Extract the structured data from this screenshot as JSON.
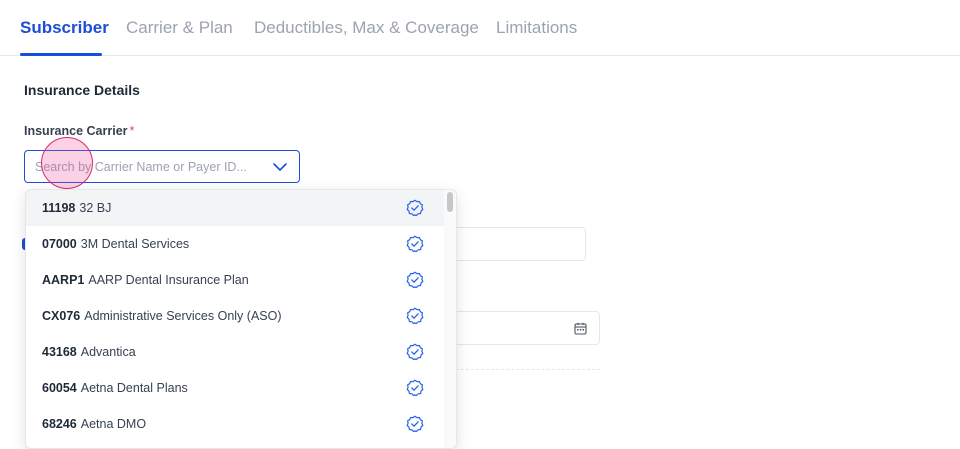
{
  "tabs": [
    {
      "label": "Subscriber",
      "active": true
    },
    {
      "label": "Carrier & Plan",
      "active": false
    },
    {
      "label": "Deductibles, Max & Coverage",
      "active": false
    },
    {
      "label": "Limitations",
      "active": false
    }
  ],
  "section": {
    "title": "Insurance Details"
  },
  "carrier_field": {
    "label": "Insurance Carrier",
    "required_mark": "*",
    "placeholder": "Search by Carrier Name or Payer ID...",
    "value": ""
  },
  "dropdown": {
    "options": [
      {
        "code": "11198",
        "name": "32 BJ",
        "verified": true
      },
      {
        "code": "07000",
        "name": "3M Dental Services",
        "verified": true
      },
      {
        "code": "AARP1",
        "name": "AARP Dental Insurance Plan",
        "verified": true
      },
      {
        "code": "CX076",
        "name": "Administrative Services Only (ASO)",
        "verified": true
      },
      {
        "code": "43168",
        "name": "Advantica",
        "verified": true
      },
      {
        "code": "60054",
        "name": "Aetna Dental Plans",
        "verified": true
      },
      {
        "code": "68246",
        "name": "Aetna DMO",
        "verified": true
      }
    ]
  },
  "colors": {
    "accent": "#1d4ed8",
    "required": "#ef4444",
    "verified_icon": "#2563eb"
  },
  "icons": {
    "dropdown_chevron": "chevron-down-icon",
    "verified": "verified-check-icon",
    "calendar": "calendar-icon"
  }
}
